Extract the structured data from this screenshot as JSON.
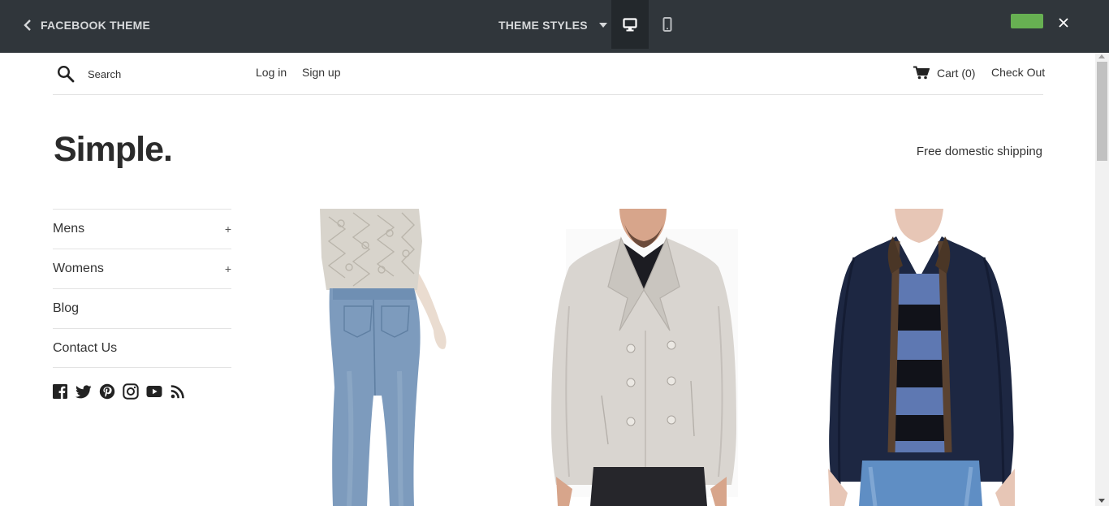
{
  "topbar": {
    "back_label": "FACEBOOK THEME",
    "styles_label": "THEME STYLES",
    "icons": [
      "chevron-left-icon",
      "caret-down-icon",
      "desktop-icon",
      "mobile-icon",
      "close-icon"
    ],
    "colors": {
      "bar": "#30363b",
      "active_device": "#23282c",
      "accent": "#67b052"
    }
  },
  "header": {
    "search": {
      "placeholder": "Search"
    },
    "login_label": "Log in",
    "signup_label": "Sign up",
    "cart_label": "Cart (0)",
    "checkout_label": "Check Out"
  },
  "brand": {
    "logo_text": "Simple.",
    "shipping_note": "Free domestic shipping"
  },
  "sidebar": {
    "items": [
      {
        "label": "Mens",
        "expand": "+"
      },
      {
        "label": "Womens",
        "expand": "+"
      },
      {
        "label": "Blog"
      },
      {
        "label": "Contact Us"
      }
    ],
    "social_icons": [
      "facebook-icon",
      "twitter-icon",
      "pinterest-icon",
      "instagram-icon",
      "youtube-icon",
      "rss-icon"
    ]
  },
  "products": [
    {
      "image": "product-jeans-image"
    },
    {
      "image": "product-peacoat-image"
    },
    {
      "image": "product-jacket-image"
    }
  ]
}
